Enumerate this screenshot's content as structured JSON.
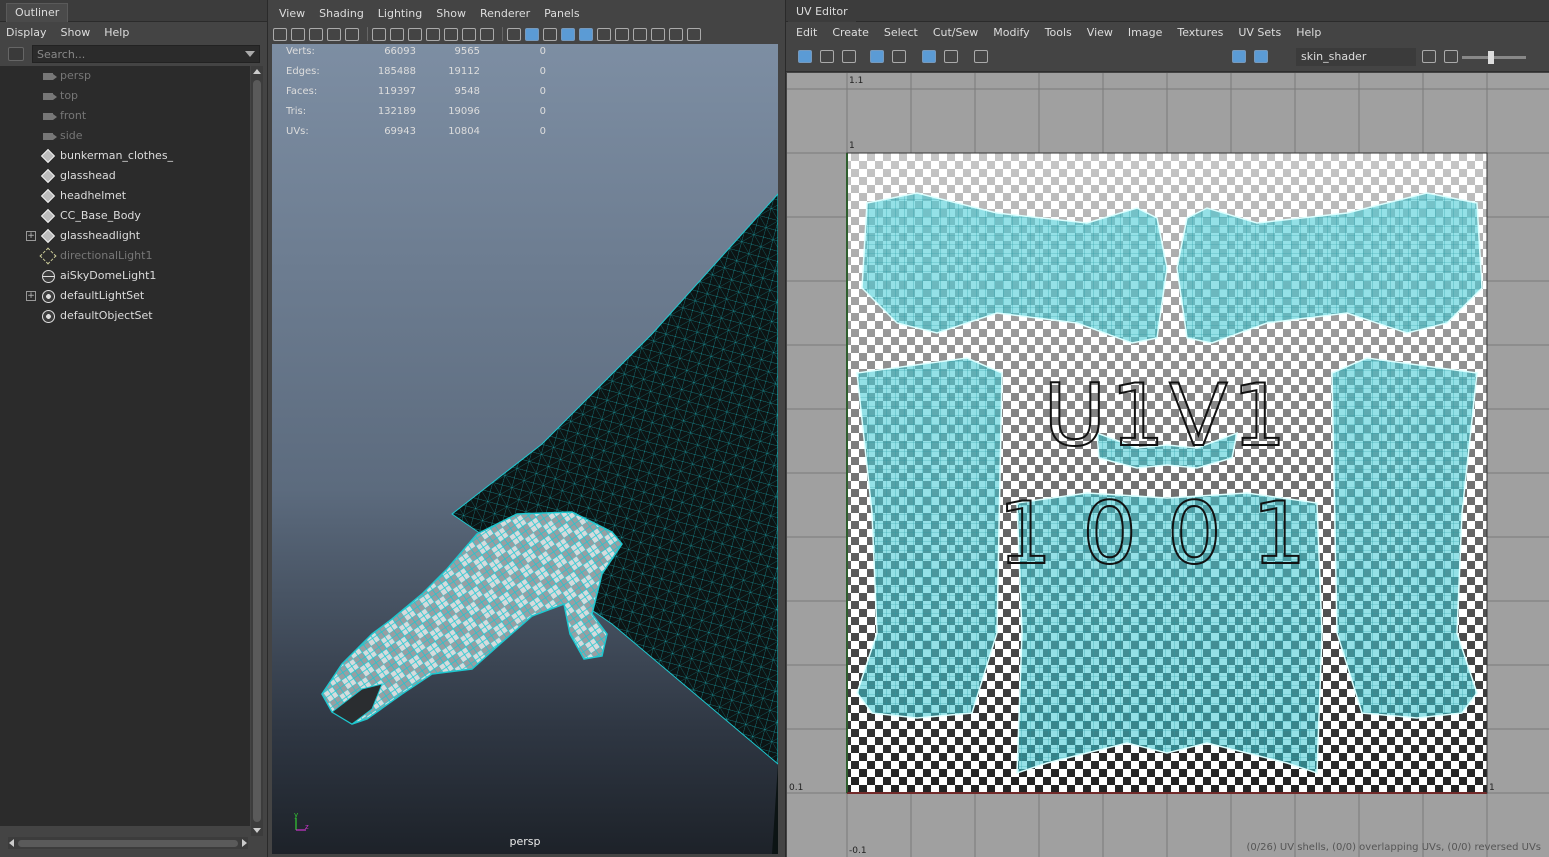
{
  "outliner": {
    "title": "Outliner",
    "menu": [
      "Display",
      "Show",
      "Help"
    ],
    "search_placeholder": "Search...",
    "items": [
      {
        "label": "persp",
        "icon": "camera-icon",
        "dim": true
      },
      {
        "label": "top",
        "icon": "camera-icon",
        "dim": true
      },
      {
        "label": "front",
        "icon": "camera-icon",
        "dim": true
      },
      {
        "label": "side",
        "icon": "camera-icon",
        "dim": true
      },
      {
        "label": "bunkerman_clothes_",
        "icon": "mesh-icon",
        "dim": false
      },
      {
        "label": "glasshead",
        "icon": "mesh-icon",
        "dim": false
      },
      {
        "label": "headhelmet",
        "icon": "mesh-icon",
        "dim": false
      },
      {
        "label": "CC_Base_Body",
        "icon": "mesh-icon",
        "dim": false
      },
      {
        "label": "glassheadlight",
        "icon": "mesh-icon",
        "dim": false,
        "expandable": true
      },
      {
        "label": "directionalLight1",
        "icon": "directional-light-icon",
        "dim": true
      },
      {
        "label": "aiSkyDomeLight1",
        "icon": "skydome-icon",
        "dim": false
      },
      {
        "label": "defaultLightSet",
        "icon": "set-icon",
        "dim": false,
        "expandable": true
      },
      {
        "label": "defaultObjectSet",
        "icon": "set-icon",
        "dim": false
      }
    ]
  },
  "viewport": {
    "menu": [
      "View",
      "Shading",
      "Lighting",
      "Show",
      "Renderer",
      "Panels"
    ],
    "camera": "persp",
    "hud": [
      {
        "key": "Verts:",
        "a": "66093",
        "b": "9565",
        "c": "0"
      },
      {
        "key": "Edges:",
        "a": "185488",
        "b": "19112",
        "c": "0"
      },
      {
        "key": "Faces:",
        "a": "119397",
        "b": "9548",
        "c": "0"
      },
      {
        "key": "Tris:",
        "a": "132189",
        "b": "19096",
        "c": "0"
      },
      {
        "key": "UVs:",
        "a": "69943",
        "b": "10804",
        "c": "0"
      }
    ],
    "axis_y": "y",
    "axis_z": "z",
    "wire_color": "#1ec8d0"
  },
  "uv_editor": {
    "title": "UV Editor",
    "menu": [
      "Edit",
      "Create",
      "Select",
      "Cut/Sew",
      "Modify",
      "Tools",
      "View",
      "Image",
      "Textures",
      "UV Sets",
      "Help"
    ],
    "shader": "skin_shader",
    "tile_text_1": "U1V1",
    "tile_text_2": "1001",
    "label_top": "1.1",
    "label_one": "1",
    "label_zero": "0.1",
    "label_right": "1",
    "label_bottom": "-0.1",
    "status": "(0/26) UV shells, (0/0) overlapping UVs, (0/0) reversed UVs",
    "shell_color": "#3cc8d2"
  }
}
